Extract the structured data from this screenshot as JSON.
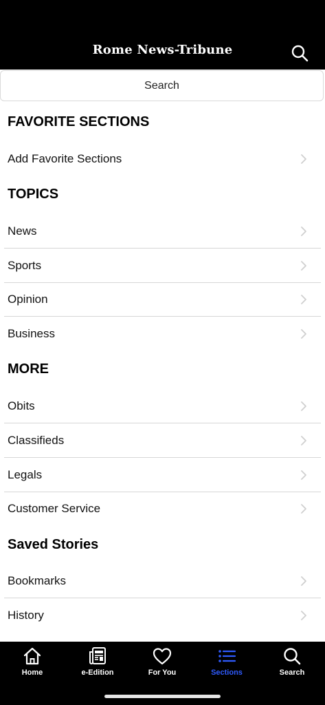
{
  "header": {
    "masthead": "Rome News-Tribune",
    "search_icon": "search-icon"
  },
  "search": {
    "placeholder": "Search"
  },
  "sections": {
    "favorite": {
      "heading": "FAVORITE SECTIONS",
      "items": [
        {
          "label": "Add Favorite Sections"
        }
      ]
    },
    "topics": {
      "heading": "TOPICS",
      "items": [
        {
          "label": "News"
        },
        {
          "label": "Sports"
        },
        {
          "label": "Opinion"
        },
        {
          "label": "Business"
        }
      ]
    },
    "more": {
      "heading": "MORE",
      "items": [
        {
          "label": "Obits"
        },
        {
          "label": "Classifieds"
        },
        {
          "label": "Legals"
        },
        {
          "label": "Customer Service"
        }
      ]
    },
    "saved": {
      "heading": "Saved Stories",
      "items": [
        {
          "label": "Bookmarks"
        },
        {
          "label": "History"
        }
      ]
    }
  },
  "tab_bar": {
    "tabs": [
      {
        "label": "Home",
        "icon": "home-icon"
      },
      {
        "label": "e-Edition",
        "icon": "newspaper-icon"
      },
      {
        "label": "For You",
        "icon": "heart-icon"
      },
      {
        "label": "Sections",
        "icon": "list-icon",
        "active": true
      },
      {
        "label": "Search",
        "icon": "search-icon"
      }
    ]
  },
  "colors": {
    "header_bg": "#000000",
    "active_tab": "#2f5bff",
    "divider": "#d6d6d6"
  }
}
